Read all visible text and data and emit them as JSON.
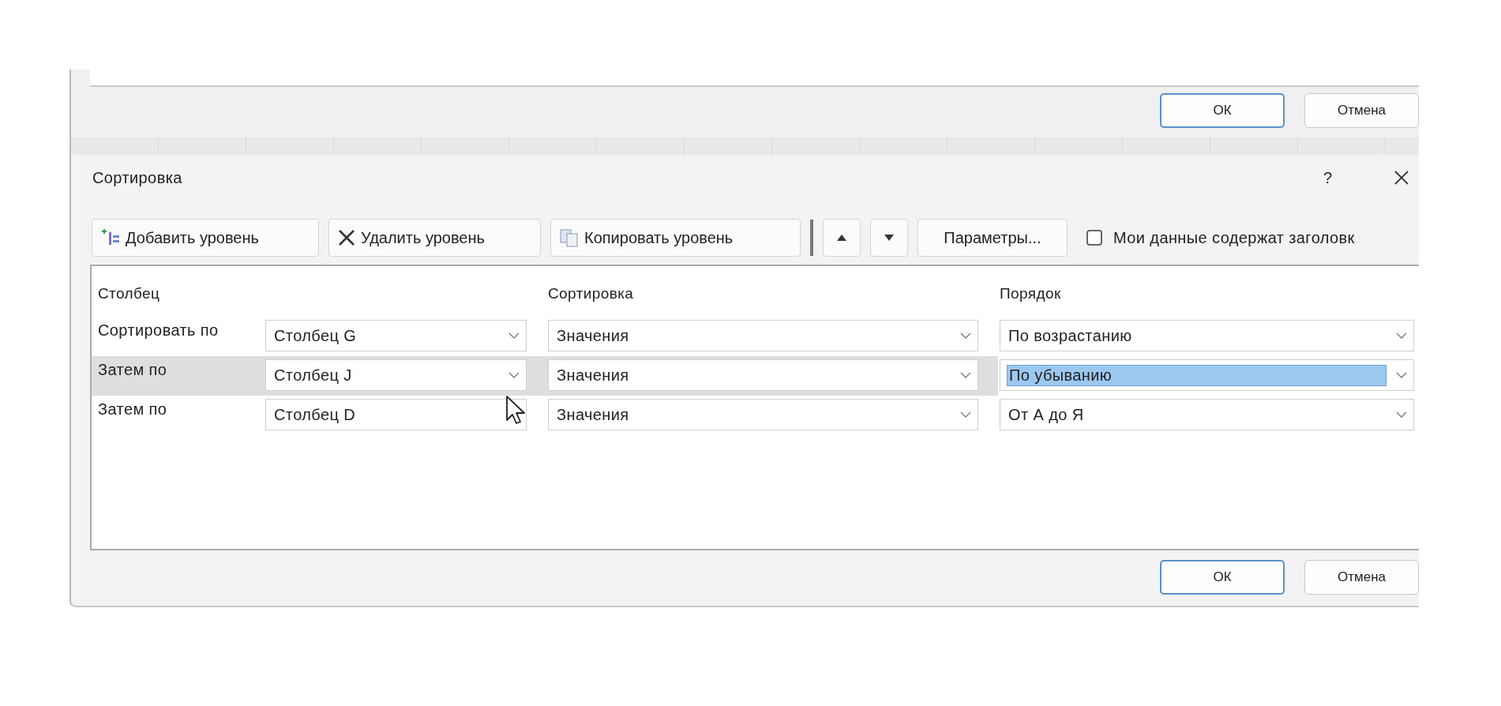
{
  "upper_dialog": {
    "buttons": [
      {
        "label": "ОК",
        "kind": "default"
      },
      {
        "label": "Отмена",
        "kind": "normal"
      }
    ]
  },
  "dialog": {
    "title": "Сортировка",
    "help": "?",
    "toolbar": [
      {
        "kind": "add",
        "label": "Добавить уровень"
      },
      {
        "kind": "delete",
        "label": "Удалить уровень"
      },
      {
        "kind": "copy",
        "label": "Копировать уровень"
      },
      {
        "kind": "up"
      },
      {
        "kind": "down"
      },
      {
        "kind": "text",
        "label": "Параметры..."
      }
    ],
    "header_checkbox": {
      "label": "Мои данные содержат заголовк",
      "checked": false
    },
    "columns": [
      "Столбец",
      "Сортировка",
      "Порядок"
    ],
    "levels": [
      {
        "label": "Сортировать по",
        "column": "Столбец G",
        "sort_on": "Значения",
        "order": "По возрастанию",
        "selected": false,
        "order_highlighted": false
      },
      {
        "label": "Затем по",
        "column": "Столбец J",
        "sort_on": "Значения",
        "order": "По убыванию",
        "selected": true,
        "order_highlighted": true
      },
      {
        "label": "Затем по",
        "column": "Столбец D",
        "sort_on": "Значения",
        "order": "От А до Я",
        "selected": false,
        "order_highlighted": false
      }
    ],
    "buttons": [
      {
        "label": "ОК",
        "kind": "default"
      },
      {
        "label": "Отмена",
        "kind": "normal"
      }
    ]
  }
}
